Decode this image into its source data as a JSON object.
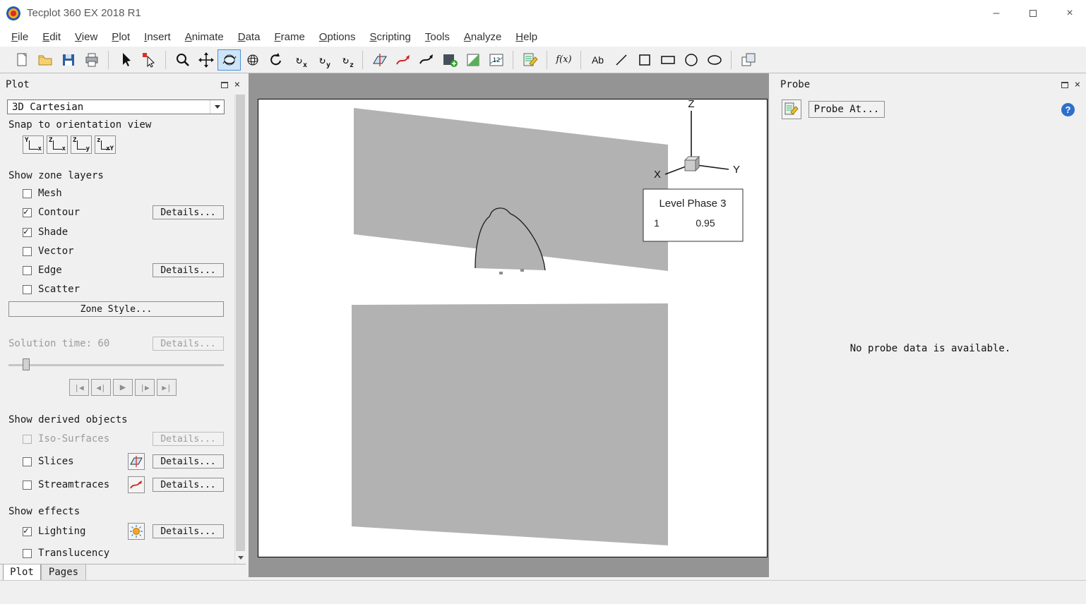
{
  "window": {
    "title": "Tecplot 360 EX 2018 R1",
    "minimize_glyph": "–",
    "close_glyph": "×"
  },
  "menu": {
    "items": [
      "File",
      "Edit",
      "View",
      "Plot",
      "Insert",
      "Animate",
      "Data",
      "Frame",
      "Options",
      "Scripting",
      "Tools",
      "Analyze",
      "Help"
    ]
  },
  "toolbar": {
    "fx_label": "f(x)",
    "text_tool_label": "Ab",
    "contour_label_glyph": "12",
    "rotate_x_letter": "x",
    "rotate_y_letter": "y",
    "rotate_z_letter": "z"
  },
  "plot_panel": {
    "title": "Plot",
    "plot_type_value": "3D Cartesian",
    "snap_label": "Snap to orientation view",
    "snap_buttons": [
      {
        "up": "Y",
        "right": "x"
      },
      {
        "up": "Z",
        "right": "x"
      },
      {
        "up": "Z",
        "right": "y"
      },
      {
        "up": "z",
        "right": "xY"
      }
    ],
    "zone_layers_label": "Show zone layers",
    "details_label": "Details...",
    "layers": [
      {
        "label": "Mesh",
        "checked": false
      },
      {
        "label": "Contour",
        "checked": true
      },
      {
        "label": "Shade",
        "checked": true
      },
      {
        "label": "Vector",
        "checked": false
      },
      {
        "label": "Edge",
        "checked": false
      },
      {
        "label": "Scatter",
        "checked": false
      }
    ],
    "zone_style_label": "Zone Style...",
    "solution_time_label": "Solution time: 60",
    "playback_icons": [
      "|◀",
      "◀|",
      "▶",
      "|▶",
      "▶|"
    ],
    "derived_label": "Show derived objects",
    "derived": [
      {
        "label": "Iso-Surfaces",
        "checked": false,
        "disabled": true
      },
      {
        "label": "Slices",
        "checked": false,
        "disabled": false
      },
      {
        "label": "Streamtraces",
        "checked": false,
        "disabled": false
      }
    ],
    "effects_label": "Show effects",
    "effects": [
      {
        "label": "Lighting",
        "checked": true
      },
      {
        "label": "Translucency",
        "checked": false
      }
    ],
    "tabs": [
      {
        "label": "Plot"
      },
      {
        "label": "Pages"
      }
    ]
  },
  "canvas": {
    "axis": {
      "x": "X",
      "y": "Y",
      "z": "Z"
    },
    "legend": {
      "title": "Level Phase 3",
      "level": "1",
      "value": "0.95"
    }
  },
  "probe_panel": {
    "title": "Probe",
    "probe_at_label": "Probe At...",
    "help_glyph": "?",
    "no_data_text": "No probe data is available."
  }
}
